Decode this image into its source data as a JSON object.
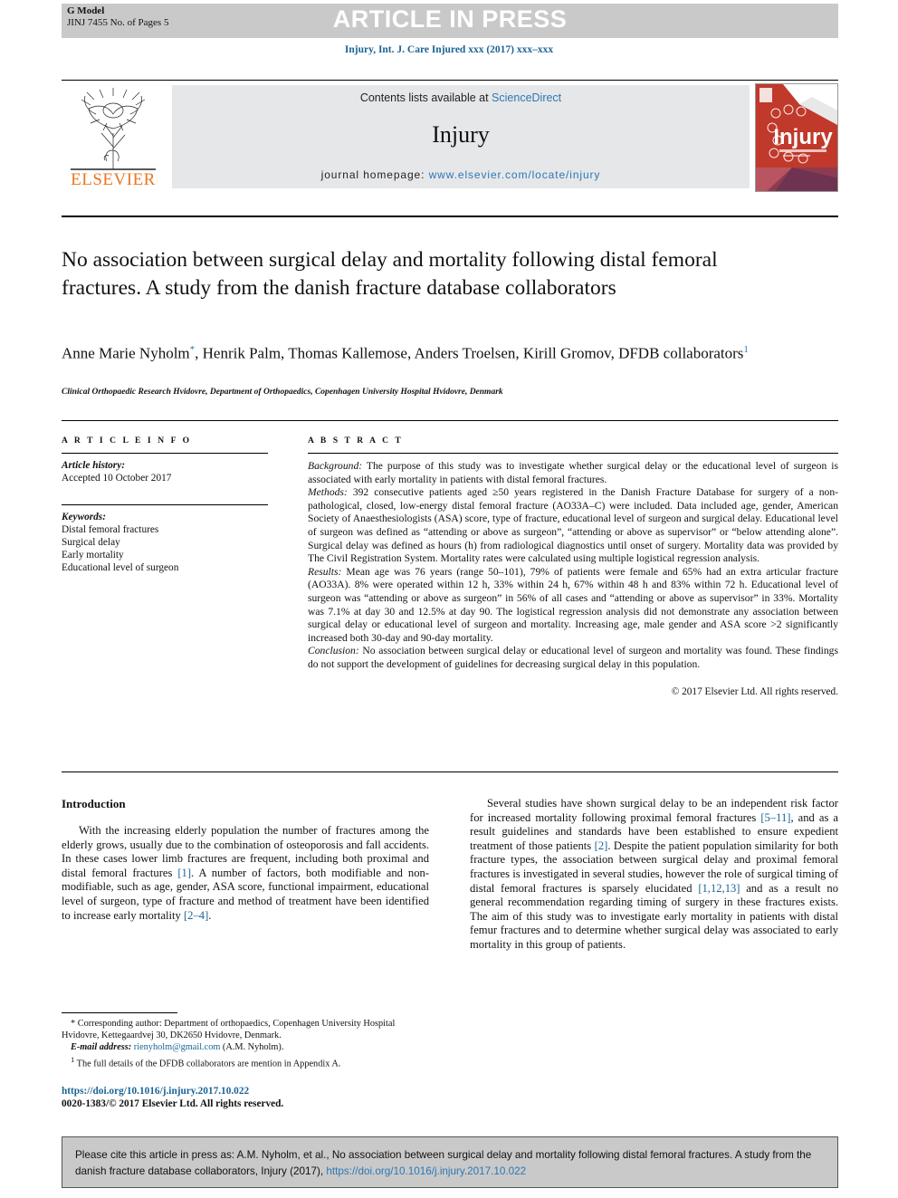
{
  "banner": {
    "g_model": "G Model",
    "g_model_sub": "JINJ 7455 No. of Pages 5",
    "press_text": "ARTICLE IN PRESS"
  },
  "journal_ref": "Injury, Int. J. Care Injured xxx (2017) xxx–xxx",
  "masthead": {
    "contents_prefix": "Contents lists available at ",
    "sciencedirect": "ScienceDirect",
    "journal_name": "Injury",
    "homepage_prefix": "journal homepage: ",
    "homepage_url": "www.elsevier.com/locate/injury",
    "publisher": "ELSEVIER",
    "cover_title": "Injury"
  },
  "article": {
    "title": "No association between surgical delay and mortality following distal femoral fractures. A study from the danish fracture database collaborators",
    "authors_line1_a": "Anne Marie Nyholm",
    "authors_mark1": "*",
    "authors_line1_b": ", Henrik Palm, Thomas Kallemose, Anders Troelsen, Kirill Gromov,",
    "authors_line2": "DFDB collaborators",
    "authors_mark2": "1",
    "affiliation": "Clinical Orthopaedic Research Hvidovre, Department of Orthopaedics, Copenhagen University Hospital Hvidovre, Denmark"
  },
  "info": {
    "heading": "A R T I C L E   I N F O",
    "history_label": "Article history:",
    "history_value": "Accepted 10 October 2017",
    "keywords_label": "Keywords:",
    "keywords": [
      "Distal femoral fractures",
      "Surgical delay",
      "Early mortality",
      "Educational level of surgeon"
    ]
  },
  "abstract": {
    "heading": "A B S T R A C T",
    "background_label": "Background:",
    "background_text": " The purpose of this study was to investigate whether surgical delay or the educational level of surgeon is associated with early mortality in patients with distal femoral fractures.",
    "methods_label": "Methods:",
    "methods_text": " 392 consecutive patients aged ≥50 years registered in the Danish Fracture Database for surgery of a non-pathological, closed, low-energy distal femoral fracture (AO33A–C) were included. Data included age, gender, American Society of Anaesthesiologists (ASA) score, type of fracture, educational level of surgeon and surgical delay. Educational level of surgeon was defined as “attending or above as surgeon”, “attending or above as supervisor” or “below attending alone”. Surgical delay was defined as hours (h) from radiological diagnostics until onset of surgery. Mortality data was provided by The Civil Registration System. Mortality rates were calculated using multiple logistical regression analysis.",
    "results_label": "Results:",
    "results_text": " Mean age was 76 years (range 50–101), 79% of patients were female and 65% had an extra articular fracture (AO33A). 8% were operated within 12 h, 33% within 24 h, 67% within 48 h and 83% within 72 h. Educational level of surgeon was “attending or above as surgeon” in 56% of all cases and “attending or above as supervisor” in 33%. Mortality was 7.1% at day 30 and 12.5% at day 90. The logistical regression analysis did not demonstrate any association between surgical delay or educational level of surgeon and mortality. Increasing age, male gender and ASA score >2 significantly increased both 30-day and 90-day mortality.",
    "conclusion_label": "Conclusion:",
    "conclusion_text": " No association between surgical delay or educational level of surgeon and mortality was found. These findings do not support the development of guidelines for decreasing surgical delay in this population.",
    "copyright": "© 2017 Elsevier Ltd. All rights reserved."
  },
  "introduction": {
    "heading": "Introduction",
    "para1_a": "With the increasing elderly population the number of fractures among the elderly grows, usually due to the combination of osteoporosis and fall accidents. In these cases lower limb fractures are frequent, including both proximal and distal femoral fractures ",
    "para1_ref1": "[1]",
    "para1_b": ". A number of factors, both modifiable and non-modifiable, such as age, gender, ASA score, functional impairment, educational level of surgeon, type of fracture and method of treatment have been identified to increase early mortality ",
    "para1_ref2": "[2–4]",
    "para1_c": ".",
    "para2_a": "Several studies have shown surgical delay to be an independent risk factor for increased mortality following proximal femoral fractures ",
    "para2_ref1": "[5–11]",
    "para2_b": ", and as a result guidelines and standards have been established to ensure expedient treatment of those patients ",
    "para2_ref2": "[2]",
    "para2_c": ". Despite the patient population similarity for both fracture types, the association between surgical delay and proximal femoral fractures is investigated in several studies, however the role of surgical timing of distal femoral fractures is sparsely elucidated ",
    "para2_ref3": "[1,12,13]",
    "para2_d": " and as a result no general recommendation regarding timing of surgery in these fractures exists. The aim of this study was to investigate early mortality in patients with distal femur fractures and to determine whether surgical delay was associated to early mortality in this group of patients."
  },
  "footnotes": {
    "corresponding_mark": "*",
    "corresponding_text": " Corresponding author: Department of orthopaedics, Copenhagen University Hospital Hvidovre, Kettegaardvej 30, DK2650 Hvidovre, Denmark.",
    "email_label": "E-mail address:",
    "email": "rienyholm@gmail.com",
    "email_suffix": " (A.M. Nyholm).",
    "fn1_mark": "1",
    "fn1_text": " The full details of the DFDB collaborators are mention in Appendix A."
  },
  "doi_block": {
    "doi": "https://doi.org/10.1016/j.injury.2017.10.022",
    "issn": "0020-1383/© 2017 Elsevier Ltd. All rights reserved."
  },
  "cite_box": {
    "text_a": "Please cite this article in press as: A.M. Nyholm, et al., No association between surgical delay and mortality following distal femoral fractures. A study from the danish fracture database collaborators, Injury (2017), ",
    "doi": "https://doi.org/10.1016/j.injury.2017.10.022"
  },
  "colors": {
    "link_blue": "#2b78b5",
    "ref_blue": "#1a6496",
    "banner_gray": "#c9c9c9",
    "masthead_gray": "#e6e7e9",
    "elsevier_orange": "#e87722"
  }
}
